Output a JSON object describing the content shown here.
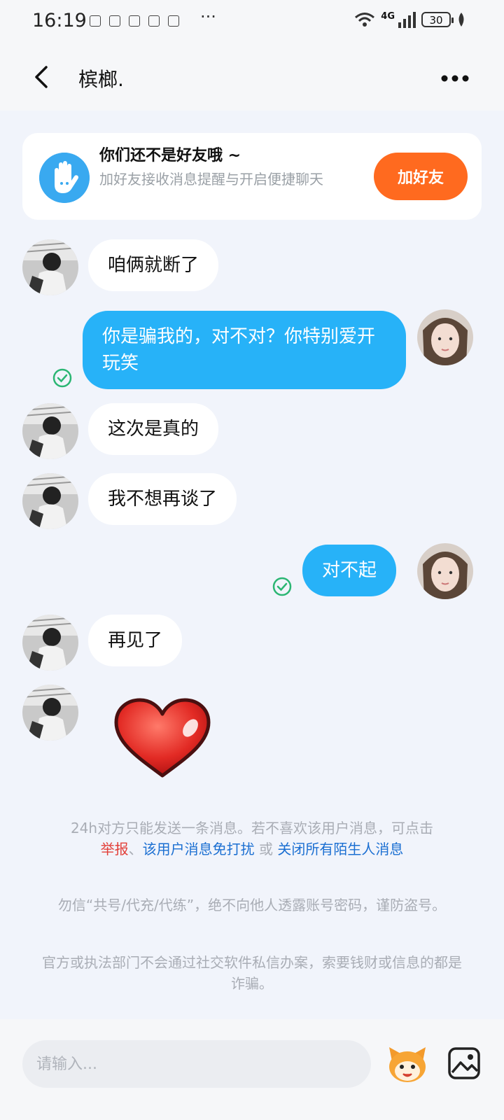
{
  "status_bar": {
    "time": "16:19",
    "overflow": "···",
    "network": "4G",
    "battery": "30"
  },
  "header": {
    "title": "槟榔."
  },
  "friend_card": {
    "title": "你们还不是好友哦 ~",
    "subtitle": "加好友接收消息提醒与开启便捷聊天",
    "button": "加好友"
  },
  "messages": [
    {
      "side": "in",
      "text": "咱俩就断了"
    },
    {
      "side": "out",
      "text": "你是骗我的，对不对？你特别爱开玩笑",
      "read": true
    },
    {
      "side": "in",
      "text": "这次是真的"
    },
    {
      "side": "in",
      "text": "我不想再谈了"
    },
    {
      "side": "out",
      "text": "对不起",
      "read": true
    },
    {
      "side": "in",
      "text": "再见了"
    },
    {
      "side": "in",
      "sticker": "heart-sticker"
    }
  ],
  "notices": {
    "limit_text": "24h对方只能发送一条消息。若不喜欢该用户消息，可点击",
    "report": "举报",
    "sep1": "、",
    "mute": "该用户消息免打扰",
    "or": " 或 ",
    "close_all": "关闭所有陌生人消息",
    "warning1": "勿信“共号/代充/代练”，绝不向他人透露账号密码，谨防盗号。",
    "warning2": "官方或执法部门不会通过社交软件私信办案，索要钱财或信息的都是诈骗。"
  },
  "input": {
    "placeholder": "请输入..."
  },
  "colors": {
    "accent_blue": "#27b2f8",
    "add_button": "#ff6a1f",
    "report_red": "#e2403a",
    "link_blue": "#1b6fd2"
  }
}
